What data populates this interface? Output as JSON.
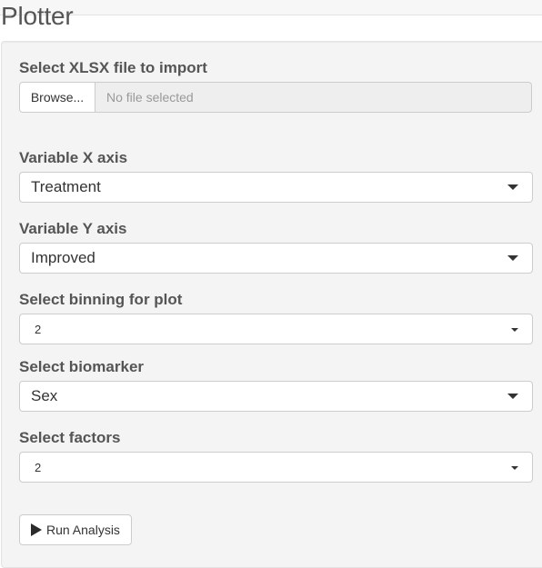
{
  "header": {
    "title": "Plotter"
  },
  "file_input": {
    "label": "Select XLSX file to import",
    "browse_label": "Browse...",
    "placeholder": "No file selected"
  },
  "fields": {
    "x_axis": {
      "label": "Variable X axis",
      "value": "Treatment"
    },
    "y_axis": {
      "label": "Variable Y axis",
      "value": "Improved"
    },
    "binning": {
      "label": "Select binning for plot",
      "value": "2"
    },
    "biomarker": {
      "label": "Select biomarker",
      "value": "Sex"
    },
    "factors": {
      "label": "Select factors",
      "value": "2"
    }
  },
  "actions": {
    "run_label": "Run Analysis",
    "run_icon": "play-icon"
  },
  "icons": {
    "dropdown": "chevron-down-icon (▼)"
  }
}
